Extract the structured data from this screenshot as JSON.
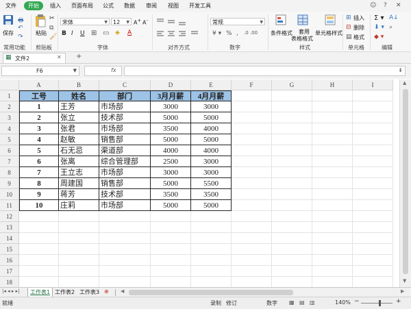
{
  "menu": {
    "items": [
      "文件",
      "开始",
      "插入",
      "页面布局",
      "公式",
      "数据",
      "审阅",
      "视图",
      "开发工具"
    ],
    "active": "开始",
    "accent": "#33a853"
  },
  "ribbon": {
    "save": "保存",
    "paste": "粘贴",
    "font_name": "宋体",
    "font_size": "12",
    "number_format": "常规",
    "conditional_format": "条件格式",
    "table_format": "套用\n表格格式",
    "table_format_l1": "套用",
    "table_format_l2": "表格格式",
    "cell_style": "单元格样式",
    "insert": "插入",
    "delete": "删除",
    "format": "格式",
    "bold": "B",
    "italic": "I",
    "underline": "U",
    "groups": {
      "common": "常用功能",
      "clipboard": "剪贴板",
      "font": "字体",
      "align": "对齐方式",
      "number": "数字",
      "styles": "样式",
      "cells": "单元格",
      "edit": "编辑"
    }
  },
  "doc_tab": {
    "name": "文件2",
    "add": "+"
  },
  "formula_bar": {
    "name_box": "F6",
    "fx": "fx",
    "value": ""
  },
  "grid": {
    "columns": [
      "A",
      "B",
      "C",
      "D",
      "E",
      "F",
      "G",
      "H",
      "I"
    ],
    "rows": [
      "1",
      "2",
      "3",
      "4",
      "5",
      "6",
      "7",
      "8",
      "9",
      "10",
      "11",
      "12",
      "13",
      "14",
      "15",
      "16",
      "17",
      "18"
    ],
    "table_header": [
      "工号",
      "姓名",
      "部门",
      "3月月薪",
      "4月月薪"
    ],
    "table_rows": [
      [
        "1",
        "王芳",
        "市场部",
        "3000",
        "3000"
      ],
      [
        "2",
        "张立",
        "技术部",
        "5000",
        "5000"
      ],
      [
        "3",
        "张君",
        "市场部",
        "3500",
        "4000"
      ],
      [
        "4",
        "赵敏",
        "销售部",
        "5000",
        "5000"
      ],
      [
        "5",
        "石无忌",
        "渠道部",
        "4000",
        "4000"
      ],
      [
        "6",
        "张离",
        "综合管理部",
        "2500",
        "3000"
      ],
      [
        "7",
        "王立志",
        "市场部",
        "3000",
        "3000"
      ],
      [
        "8",
        "周建国",
        "销售部",
        "5000",
        "5500"
      ],
      [
        "9",
        "蒋芳",
        "技术部",
        "3500",
        "3500"
      ],
      [
        "10",
        "庄莉",
        "市场部",
        "5000",
        "5000"
      ]
    ],
    "header_fill": "#9dc3e6"
  },
  "sheets": {
    "tabs": [
      "工作表1",
      "工作表2",
      "工作表3"
    ],
    "active": "工作表1"
  },
  "status_bar": {
    "ready": "就绪",
    "record": "录制",
    "revise": "修订",
    "numlock": "数字",
    "zoom": "140%",
    "zoom_minus": "−",
    "zoom_plus": "+"
  }
}
